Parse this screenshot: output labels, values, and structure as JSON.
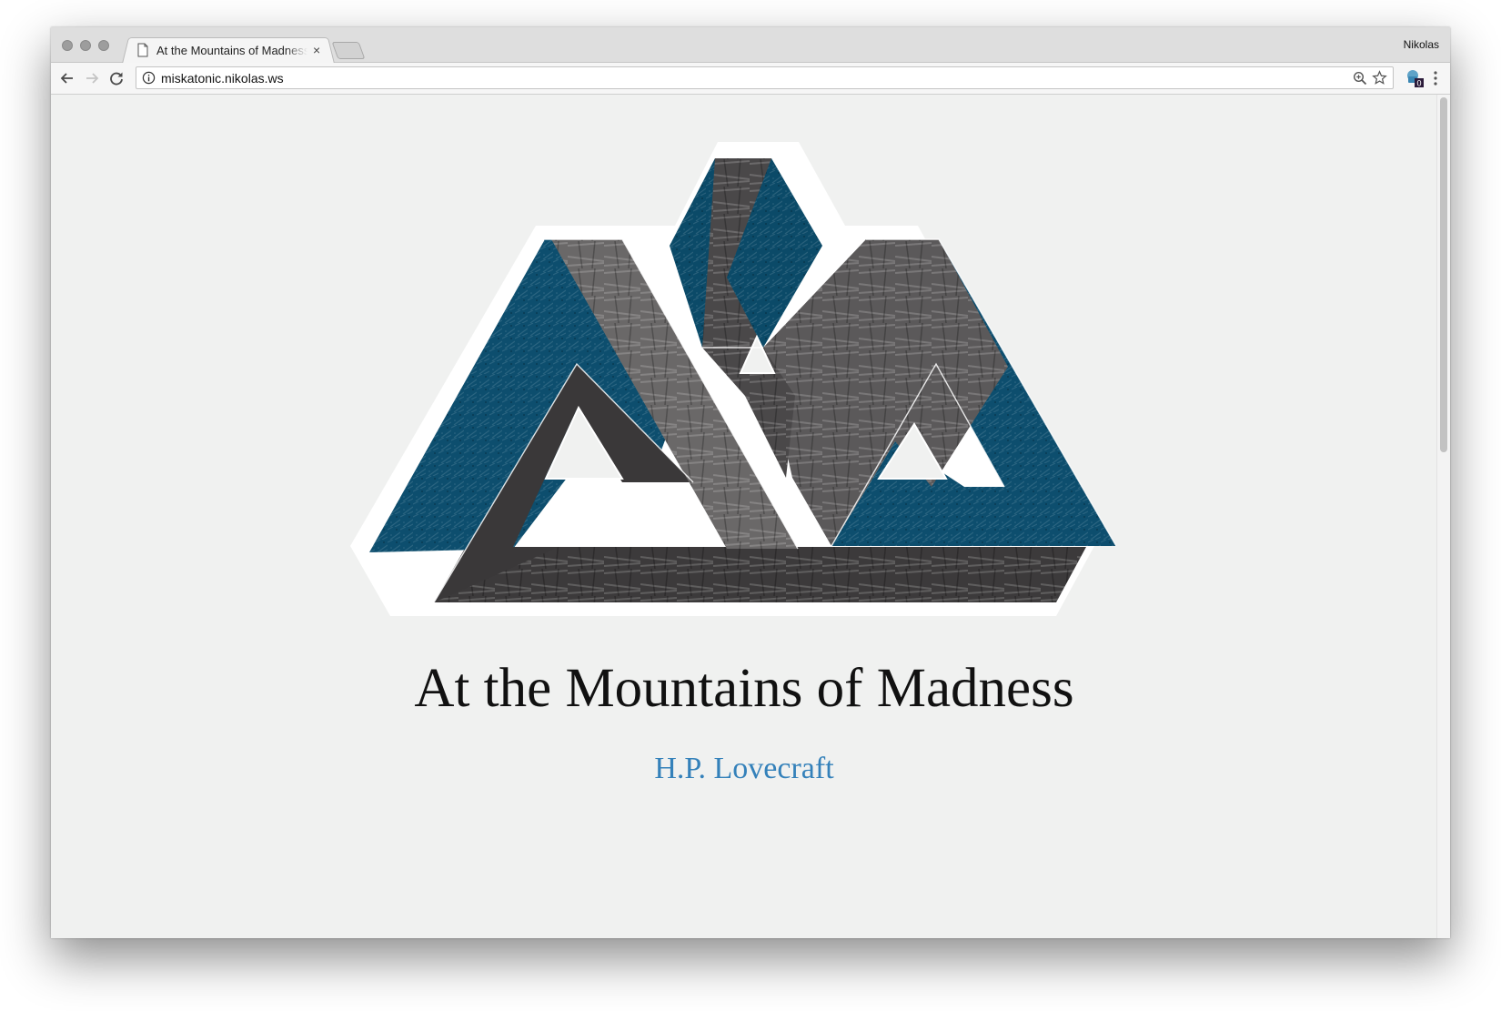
{
  "browser": {
    "tab": {
      "title": "At the Mountains of Madness",
      "close_glyph": "×"
    },
    "profile_name": "Nikolas",
    "address_bar": {
      "url": "miskatonic.nikolas.ws"
    },
    "extension_badge": "0"
  },
  "page": {
    "title": "At the Mountains of Madness",
    "author": "H.P. Lovecraft",
    "colors": {
      "background": "#f0f1f0",
      "author_link": "#3481ba",
      "art_blue": "#0d4e6e",
      "art_dark": "#3a3839",
      "art_grey": "#6c6a6a"
    }
  }
}
